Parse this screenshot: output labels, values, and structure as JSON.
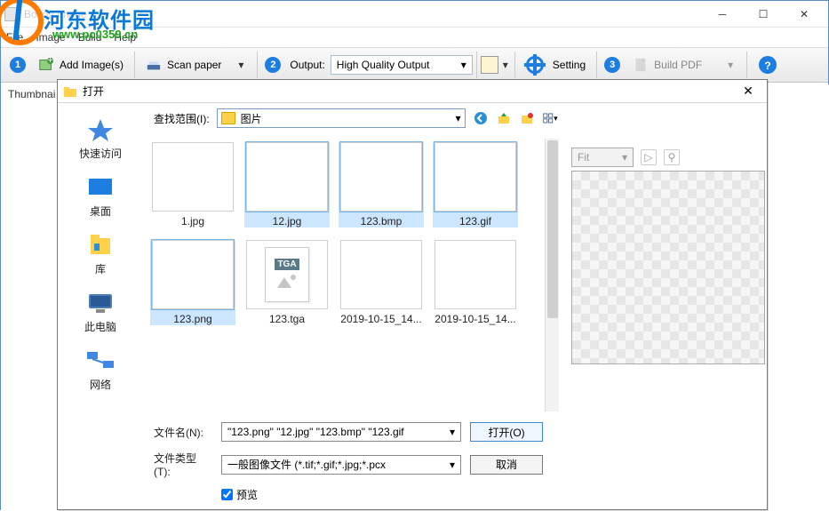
{
  "app": {
    "title": "Boxoft Image ...",
    "menus": [
      "File",
      "Image",
      "Build",
      "Help"
    ]
  },
  "watermark": {
    "name": "河东软件园",
    "url": "www.pc0359.cn"
  },
  "toolbar": {
    "step1": "1",
    "add_images": "Add Image(s)",
    "scan_paper": "Scan paper",
    "step2": "2",
    "output_label": "Output:",
    "output_value": "High Quality Output",
    "setting": "Setting",
    "step3": "3",
    "build_pdf": "Build PDF"
  },
  "panel": {
    "thumbnails": "Thumbnai"
  },
  "dialog": {
    "title": "打开",
    "look_in_label": "查找范围(I):",
    "look_in_value": "图片",
    "fit": "Fit",
    "sidebar": [
      {
        "label": "快速访问"
      },
      {
        "label": "桌面"
      },
      {
        "label": "库"
      },
      {
        "label": "此电脑"
      },
      {
        "label": "网络"
      }
    ],
    "files": [
      {
        "name": "1.jpg",
        "sel": false,
        "thumb": "t-white"
      },
      {
        "name": "12.jpg",
        "sel": true,
        "thumb": "t-photo"
      },
      {
        "name": "123.bmp",
        "sel": true,
        "thumb": "t-magenta"
      },
      {
        "name": "123.gif",
        "sel": true,
        "thumb": "t-gif"
      },
      {
        "name": "123.png",
        "sel": true,
        "thumb": "t-png"
      },
      {
        "name": "123.tga",
        "sel": false,
        "thumb": "t-tga"
      },
      {
        "name": "2019-10-15_14...",
        "sel": false,
        "thumb": "t-land1"
      },
      {
        "name": "2019-10-15_14...",
        "sel": false,
        "thumb": "t-land2"
      }
    ],
    "filename_label": "文件名(N):",
    "filename_value": "\"123.png\" \"12.jpg\" \"123.bmp\" \"123.gif",
    "filetype_label": "文件类型(T):",
    "filetype_value": "一般图像文件 (*.tif;*.gif;*.jpg;*.pcx",
    "open_btn": "打开(O)",
    "cancel_btn": "取消",
    "preview_chk": "预览"
  }
}
